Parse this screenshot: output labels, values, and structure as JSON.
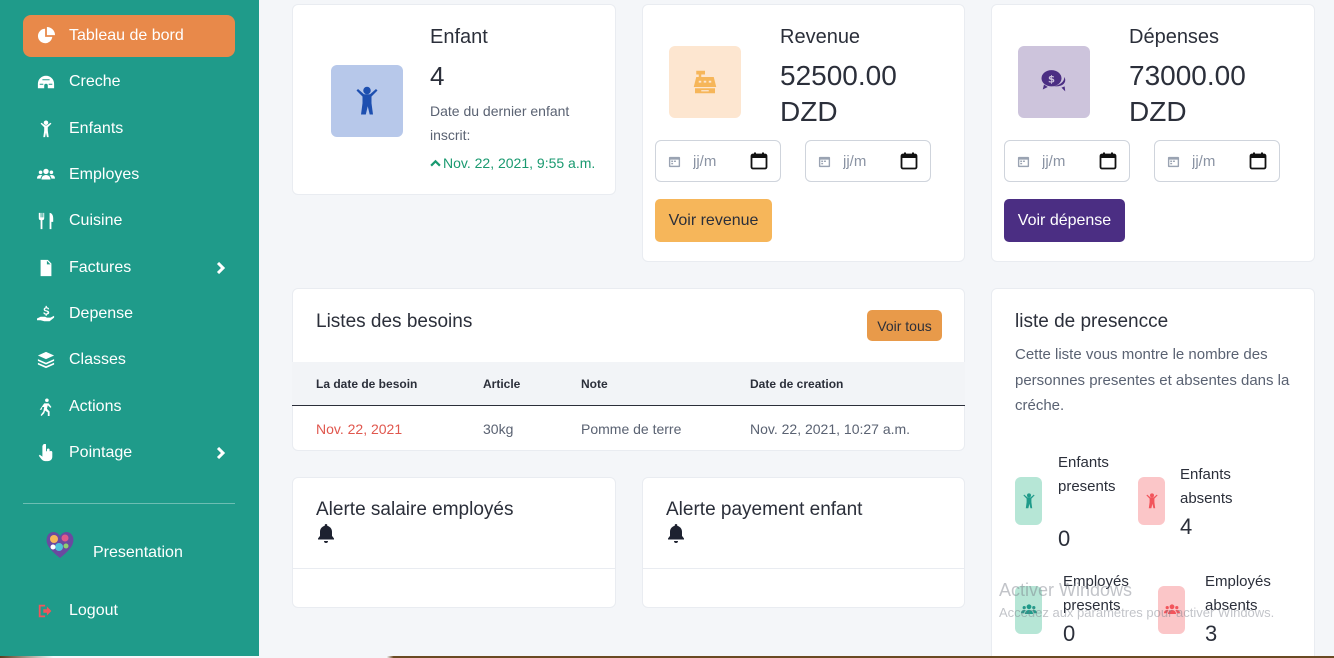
{
  "sidebar": {
    "items": [
      {
        "label": "Tableau de bord",
        "icon": "pie-chart-icon",
        "active": true
      },
      {
        "label": "Creche",
        "icon": "igloo-icon"
      },
      {
        "label": "Enfants",
        "icon": "child-icon"
      },
      {
        "label": "Employes",
        "icon": "users-icon"
      },
      {
        "label": "Cuisine",
        "icon": "utensils-icon"
      },
      {
        "label": "Factures",
        "icon": "invoice-icon",
        "has_submenu": true
      },
      {
        "label": "Depense",
        "icon": "hand-holding-dollar-icon"
      },
      {
        "label": "Classes",
        "icon": "layers-icon"
      },
      {
        "label": "Actions",
        "icon": "person-running-icon"
      },
      {
        "label": "Pointage",
        "icon": "hand-pointer-icon",
        "has_submenu": true
      }
    ],
    "presentation_label": "Presentation",
    "logout_label": "Logout"
  },
  "enfant_card": {
    "title": "Enfant",
    "value": "4",
    "desc": "Date du dernier enfant inscrit:",
    "last_date": "Nov. 22, 2021, 9:55 a.m."
  },
  "revenue_card": {
    "title": "Revenue",
    "value": "52500.00 DZD",
    "date_placeholder_1": "jj/m",
    "date_placeholder_2": "jj/m",
    "button": "Voir revenue"
  },
  "depenses_card": {
    "title": "Dépenses",
    "value": "73000.00 DZD",
    "date_placeholder_1": "jj/m",
    "date_placeholder_2": "jj/m",
    "button": "Voir dépense"
  },
  "besoins": {
    "title": "Listes des besoins",
    "button": "Voir tous",
    "columns": [
      "La date de besoin",
      "Article",
      "Note",
      "Date de creation"
    ],
    "rows": [
      {
        "date": "Nov. 22, 2021",
        "article": "30kg",
        "note": "Pomme de terre",
        "created": "Nov. 22, 2021, 10:27 a.m."
      }
    ]
  },
  "alerte_salaire": {
    "title": "Alerte salaire employés"
  },
  "alerte_payement": {
    "title": "Alerte payement enfant"
  },
  "presence": {
    "title": "liste de presencce",
    "desc": "Cette liste vous montre le nombre des personnes presentes et absentes dans la créche.",
    "enfants_presents_label": "Enfants presents",
    "enfants_presents": "0",
    "enfants_absents_label": "Enfants absents",
    "enfants_absents": "4",
    "employes_presents_label": "Employés presents",
    "employes_presents": "0",
    "employes_absents_label": "Employés absents",
    "employes_absents": "3"
  },
  "watermark": {
    "title": "Activer Windows",
    "subtitle": "Accédez aux paramètres pour activer Windows."
  },
  "colors": {
    "sidebar": "#1f9b8a",
    "active": "#e8894a",
    "revenue_button": "#f6b65a",
    "depense_button": "#4b2e83",
    "present": "#1f9b8a",
    "absent": "#f2545b"
  }
}
